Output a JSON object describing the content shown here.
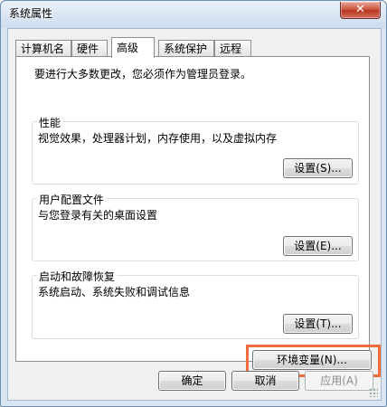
{
  "window": {
    "title": "系统属性",
    "close_glyph": "✕"
  },
  "tabs": [
    {
      "label": "计算机名"
    },
    {
      "label": "硬件"
    },
    {
      "label": "高级",
      "active": true
    },
    {
      "label": "系统保护"
    },
    {
      "label": "远程"
    }
  ],
  "panel": {
    "notice": "要进行大多数更改，您必须作为管理员登录。",
    "performance": {
      "title": "性能",
      "desc": "视觉效果，处理器计划，内存使用，以及虚拟内存",
      "button": "设置(S)..."
    },
    "profiles": {
      "title": "用户配置文件",
      "desc": "与您登录有关的桌面设置",
      "button": "设置(E)..."
    },
    "startup": {
      "title": "启动和故障恢复",
      "desc": "系统启动、系统失败和调试信息",
      "button": "设置(T)..."
    },
    "env_button": "环境变量(N)...",
    "highlight_color": "#f36d3c"
  },
  "footer": {
    "ok": "确定",
    "cancel": "取消",
    "apply": "应用(A)"
  }
}
